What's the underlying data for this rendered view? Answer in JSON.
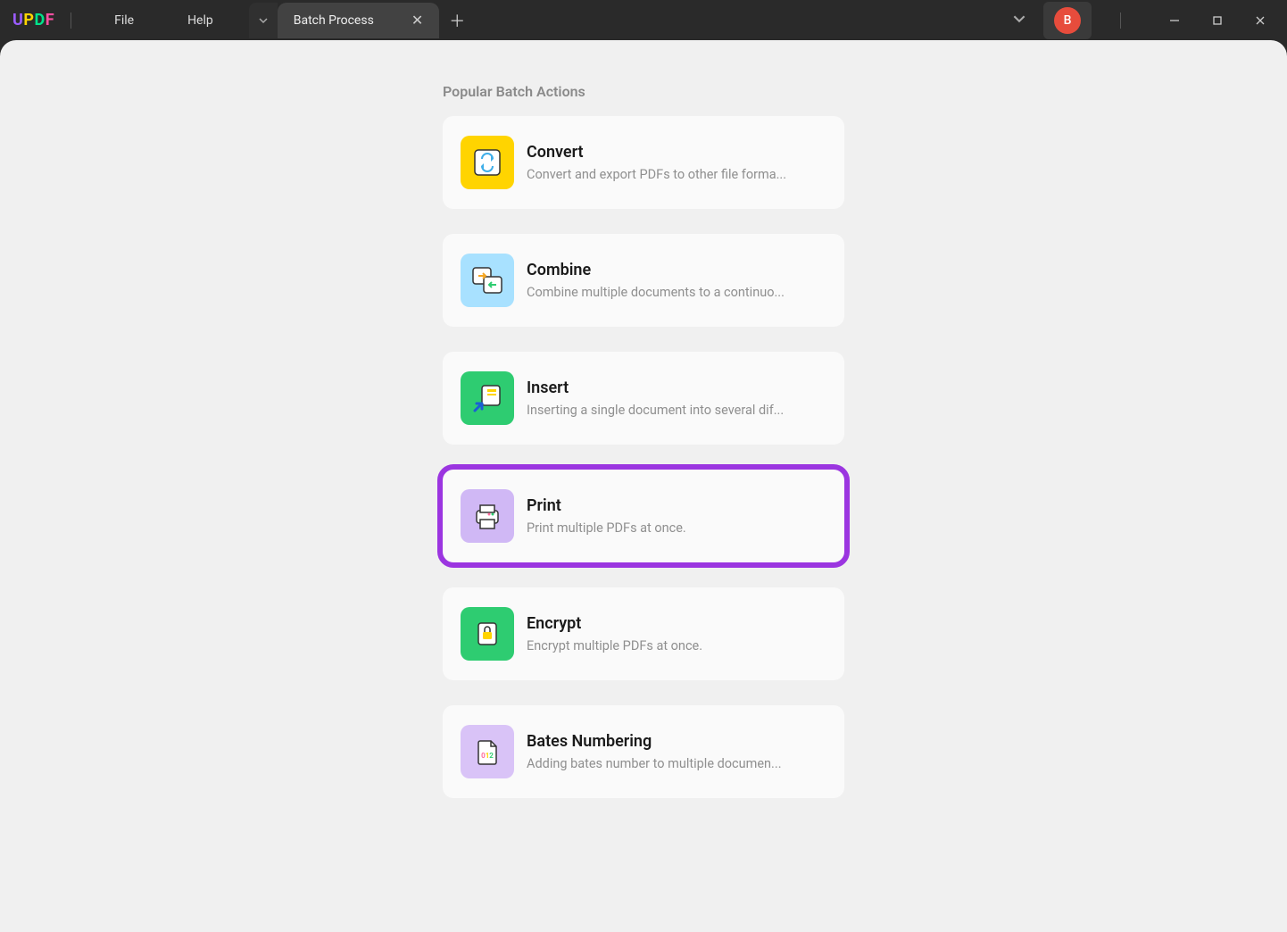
{
  "app": {
    "name": "UPDF",
    "menu": {
      "file": "File",
      "help": "Help"
    },
    "tab": {
      "title": "Batch Process"
    },
    "user": {
      "avatar_initial": "B"
    }
  },
  "section_title": "Popular Batch Actions",
  "actions": {
    "convert": {
      "title": "Convert",
      "desc": "Convert and export PDFs to other file forma..."
    },
    "combine": {
      "title": "Combine",
      "desc": "Combine multiple documents to a continuo..."
    },
    "insert": {
      "title": "Insert",
      "desc": "Inserting a single document into several dif..."
    },
    "print": {
      "title": "Print",
      "desc": "Print multiple PDFs at once.",
      "highlighted": true
    },
    "encrypt": {
      "title": "Encrypt",
      "desc": "Encrypt multiple PDFs at once."
    },
    "bates": {
      "title": "Bates Numbering",
      "desc": "Adding bates number to multiple documen..."
    }
  }
}
